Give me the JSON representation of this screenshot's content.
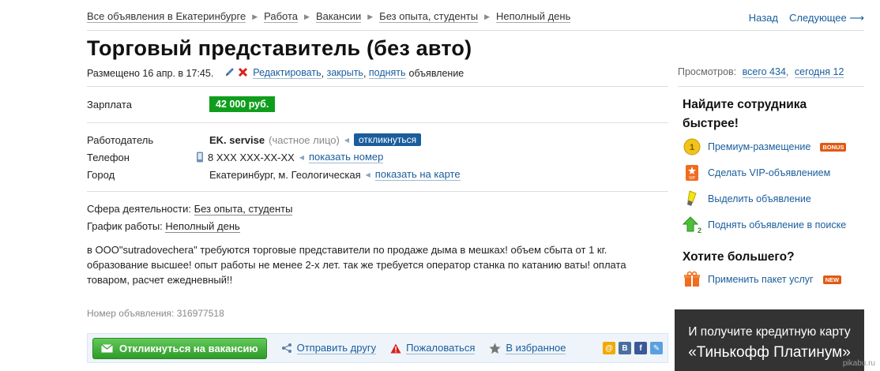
{
  "breadcrumb": [
    "Все объявления в Екатеринбурге",
    "Работа",
    "Вакансии",
    "Без опыта, студенты",
    "Неполный день"
  ],
  "nav": {
    "back": "Назад",
    "next": "Следующее ⟶"
  },
  "title": "Торговый представитель (без авто)",
  "meta": {
    "posted": "Размещено 16 апр. в 17:45.",
    "edit": "Редактировать",
    "close": "закрыть",
    "raise": "поднять",
    "suffix": "объявление"
  },
  "views": {
    "label": "Просмотров:",
    "total": "всего 434",
    "today": "сегодня 12"
  },
  "salary": {
    "label": "Зарплата",
    "value": "42 000 руб."
  },
  "employer": {
    "label": "Работодатель",
    "name": "EK. servise",
    "type": "(частное лицо)",
    "respond": "откликнуться"
  },
  "phone": {
    "label": "Телефон",
    "value": "8 XXX XXX-XX-XX",
    "show": "показать номер"
  },
  "city": {
    "label": "Город",
    "value": "Екатеринбург, м. Геологическая",
    "map": "показать на карте"
  },
  "sphere": {
    "label": "Сфера деятельности:",
    "value": "Без опыта, студенты"
  },
  "schedule": {
    "label": "График работы:",
    "value": "Неполный день"
  },
  "description": "в ООО\"sutradovechera\" требуются торговые представители по продаже дыма в мешках! объем сбыта от 1 кг. образование высшее! опыт работы не менее 2-х лет. так же требуется оператор станка по катанию ваты! оплата товаром, расчет ежедневный!!",
  "ad_number": "Номер объявления: 316977518",
  "actions": {
    "apply": "Откликнуться на вакансию",
    "send": "Отправить другу",
    "report": "Пожаловаться",
    "favorite": "В избранное"
  },
  "promo": {
    "heading": "Найдите сотрудника быстрее!",
    "items": [
      {
        "label": "Премиум-размещение",
        "badge": "BONUS"
      },
      {
        "label": "Сделать VIP-объявлением"
      },
      {
        "label": "Выделить объявление"
      },
      {
        "label": "Поднять объявление в поиске"
      }
    ],
    "heading2": "Хотите большего?",
    "package": {
      "label": "Применить пакет услуг",
      "badge": "NEW"
    }
  },
  "banner": {
    "line1": "И получите кредитную карту",
    "line2": "«Тинькофф Платинум»"
  },
  "watermark": "pikabu.ru",
  "colors": {
    "salary": "#0f9e1c",
    "link": "#1a5d9c",
    "apply": "#3fae36"
  }
}
